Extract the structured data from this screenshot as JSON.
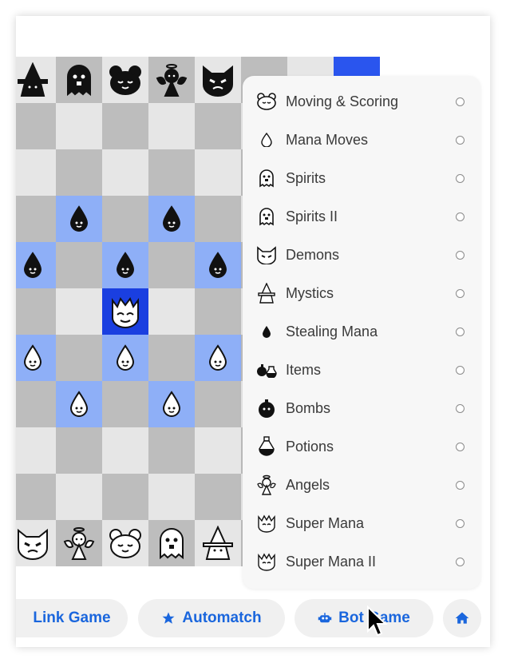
{
  "menu": {
    "items": [
      {
        "label": "Moving & Scoring",
        "icon": "bear-face-icon"
      },
      {
        "label": "Mana Moves",
        "icon": "mana-drop-icon"
      },
      {
        "label": "Spirits",
        "icon": "ghost-icon"
      },
      {
        "label": "Spirits II",
        "icon": "ghost-icon"
      },
      {
        "label": "Demons",
        "icon": "demon-face-icon"
      },
      {
        "label": "Mystics",
        "icon": "wizard-icon"
      },
      {
        "label": "Stealing Mana",
        "icon": "dark-drop-icon"
      },
      {
        "label": "Items",
        "icon": "bomb-potion-icon"
      },
      {
        "label": "Bombs",
        "icon": "bomb-icon"
      },
      {
        "label": "Potions",
        "icon": "potion-icon"
      },
      {
        "label": "Angels",
        "icon": "angel-icon"
      },
      {
        "label": "Super Mana",
        "icon": "super-mana-icon"
      },
      {
        "label": "Super Mana II",
        "icon": "super-mana-icon"
      }
    ]
  },
  "buttons": {
    "link_game": "Link Game",
    "automatch": "Automatch",
    "bot_game": "Bot Game",
    "home_icon": "home-icon"
  },
  "colors": {
    "accent": "#1a66dd",
    "highlight": "#8eaff7",
    "selected": "#1a3fe0",
    "light_square": "#e6e6e6",
    "dark_square": "#bdbdbd"
  }
}
